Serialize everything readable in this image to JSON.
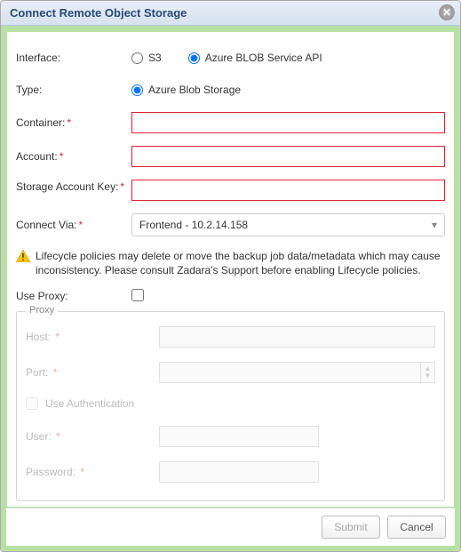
{
  "dialog": {
    "title": "Connect Remote Object Storage"
  },
  "form": {
    "interface_label": "Interface:",
    "interface_options": {
      "s3": "S3",
      "azure": "Azure BLOB Service API"
    },
    "interface_selected": "azure",
    "type_label": "Type:",
    "type_option": "Azure Blob Storage",
    "container_label": "Container:",
    "account_label": "Account:",
    "storage_key_label": "Storage Account Key:",
    "connect_via_label": "Connect Via:",
    "connect_via_value": "Frontend - 10.2.14.158",
    "container_value": "",
    "account_value": "",
    "storage_key_value": ""
  },
  "warning": {
    "text": "Lifecycle policies may delete or move the backup job data/metadata which may cause inconsistency. Please consult Zadara's Support before enabling Lifecycle policies."
  },
  "proxy": {
    "use_proxy_label": "Use Proxy:",
    "use_proxy_checked": false,
    "legend": "Proxy",
    "host_label": "Host:",
    "port_label": "Port:",
    "use_auth_label": "Use Authentication",
    "user_label": "User:",
    "password_label": "Password:",
    "host_value": "",
    "port_value": "",
    "user_value": "",
    "password_value": ""
  },
  "footer": {
    "submit": "Submit",
    "cancel": "Cancel"
  }
}
